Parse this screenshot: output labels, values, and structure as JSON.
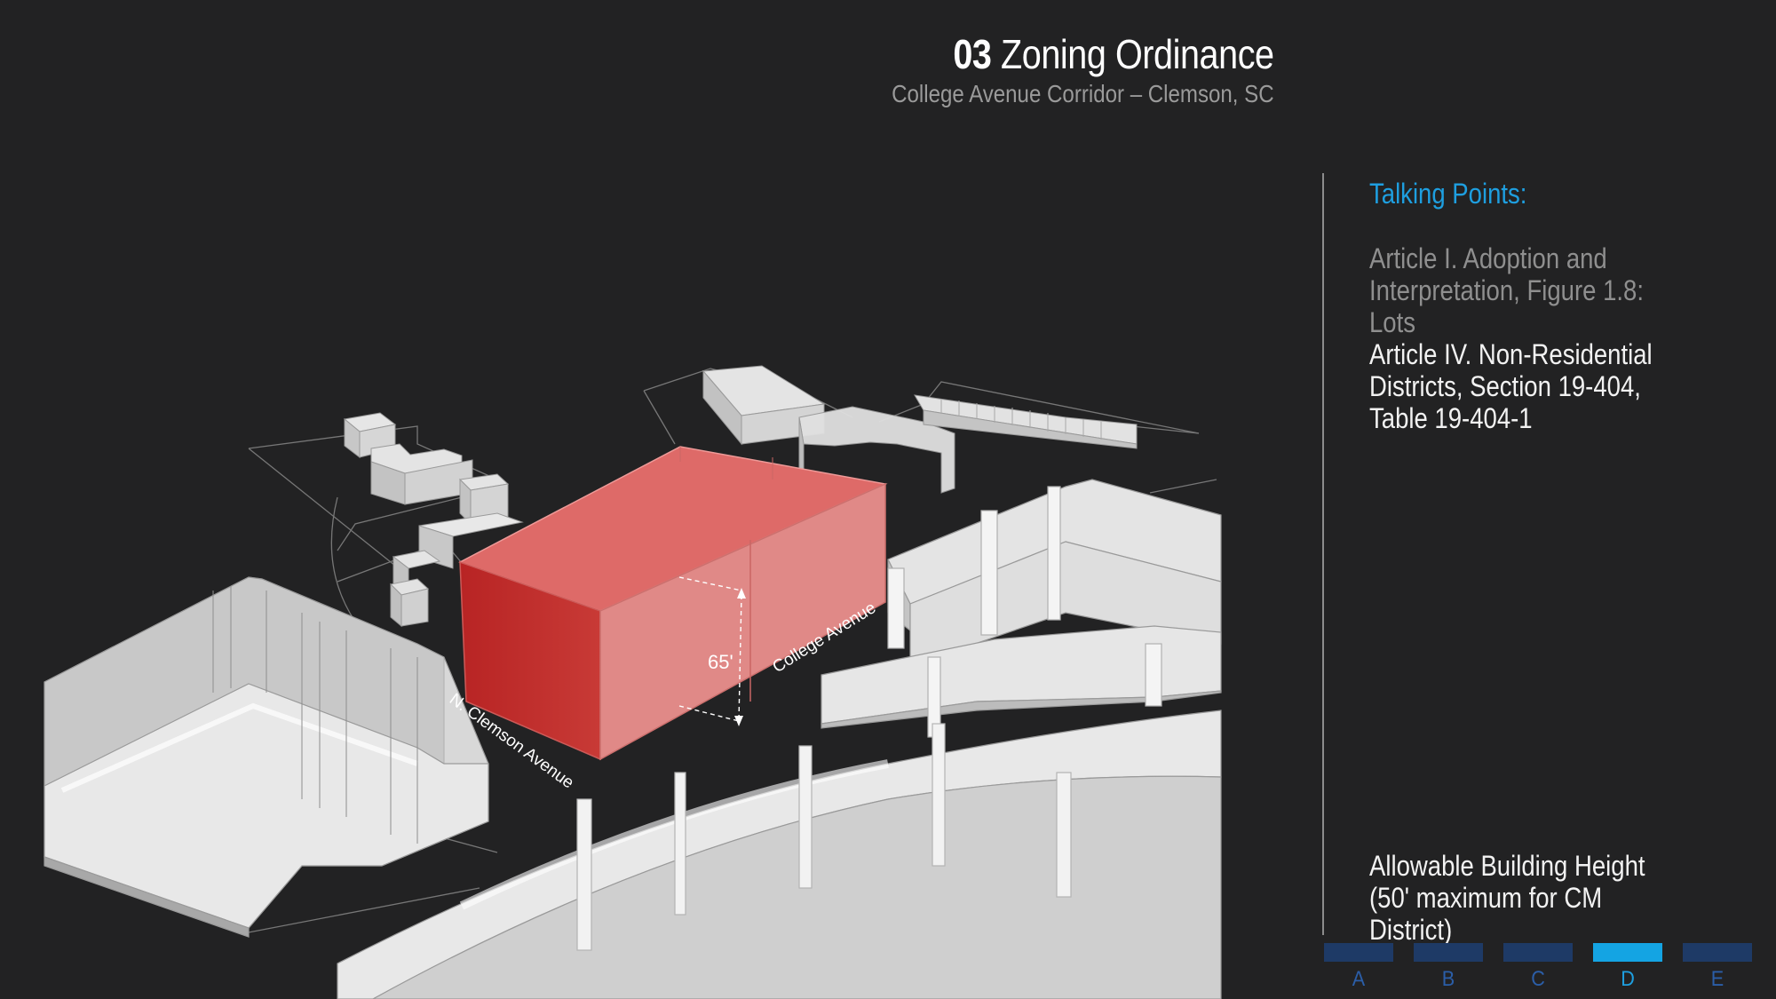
{
  "header": {
    "section_number": "03",
    "title": "Zoning Ordinance",
    "subtitle": "College Avenue Corridor – Clemson, SC"
  },
  "diagram": {
    "streets": [
      "N. Clemson Avenue",
      "College Avenue"
    ],
    "height_dimension": "65'",
    "highlight_color": "#d23c3c",
    "building_color": "#d6d6d6"
  },
  "talking_points": {
    "heading": "Talking Points:",
    "items": [
      "Article I. Adoption and Interpretation, Figure 1.8: Lots",
      "Article IV. Non-Residential Districts, Section 19-404, Table 19-404-1"
    ],
    "footer_note": "Allowable Building Height (50' maximum for CM District)"
  },
  "nav_tabs": [
    {
      "label": "A",
      "active": false
    },
    {
      "label": "B",
      "active": false
    },
    {
      "label": "C",
      "active": false
    },
    {
      "label": "D",
      "active": true
    },
    {
      "label": "E",
      "active": false
    }
  ],
  "colors": {
    "background": "#222223",
    "accent": "#1e9fe0",
    "tab_inactive": "#1e3a66",
    "tab_active": "#14a4e3"
  }
}
